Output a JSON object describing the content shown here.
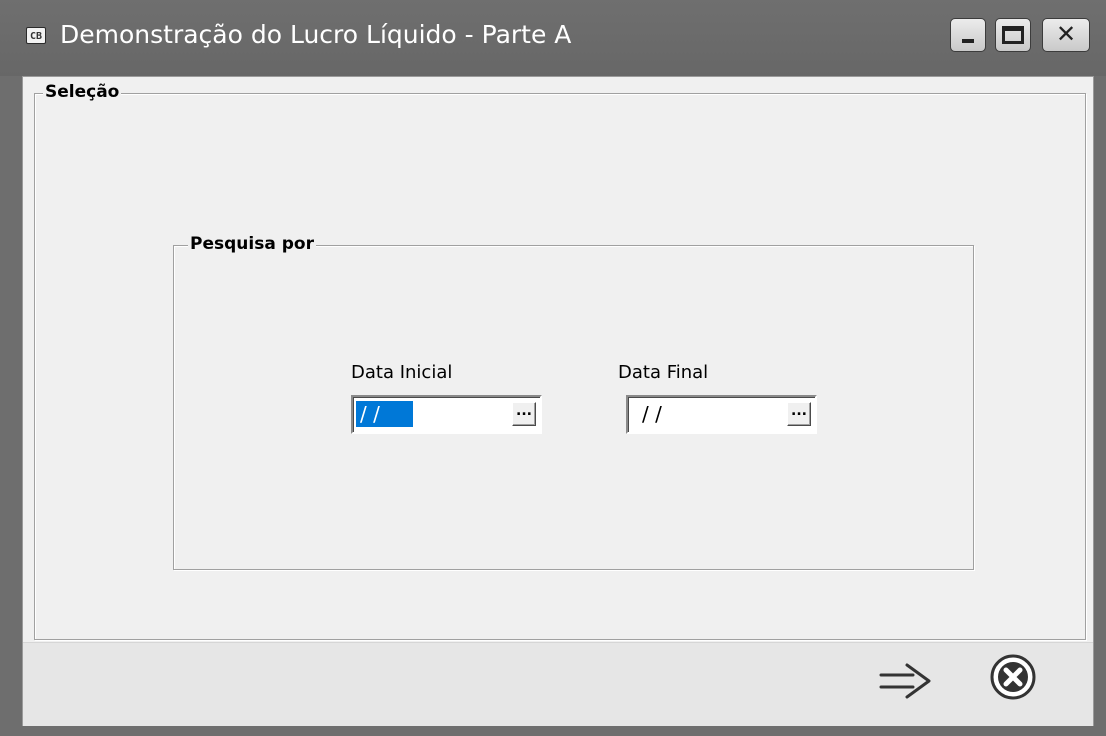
{
  "window": {
    "app_icon_text": "CB",
    "title": "Demonstração do Lucro Líquido - Parte A",
    "controls": [
      "minimize-icon",
      "maximize-icon",
      "close-icon"
    ]
  },
  "selection_group": {
    "label": "Seleção",
    "search_group": {
      "label": "Pesquisa por",
      "start_date": {
        "label": "Data Inicial",
        "value": " / /",
        "button_label": "...",
        "selected": true
      },
      "end_date": {
        "label": "Data Final",
        "value": "/ /",
        "button_label": "..."
      }
    }
  },
  "footer": {
    "icons": [
      "arrow-right-icon",
      "cancel-circle-icon"
    ]
  },
  "colors": {
    "titlebar": "#6e6e6e",
    "client_bg": "#f0f0f0",
    "selection_highlight": "#0078d7"
  }
}
